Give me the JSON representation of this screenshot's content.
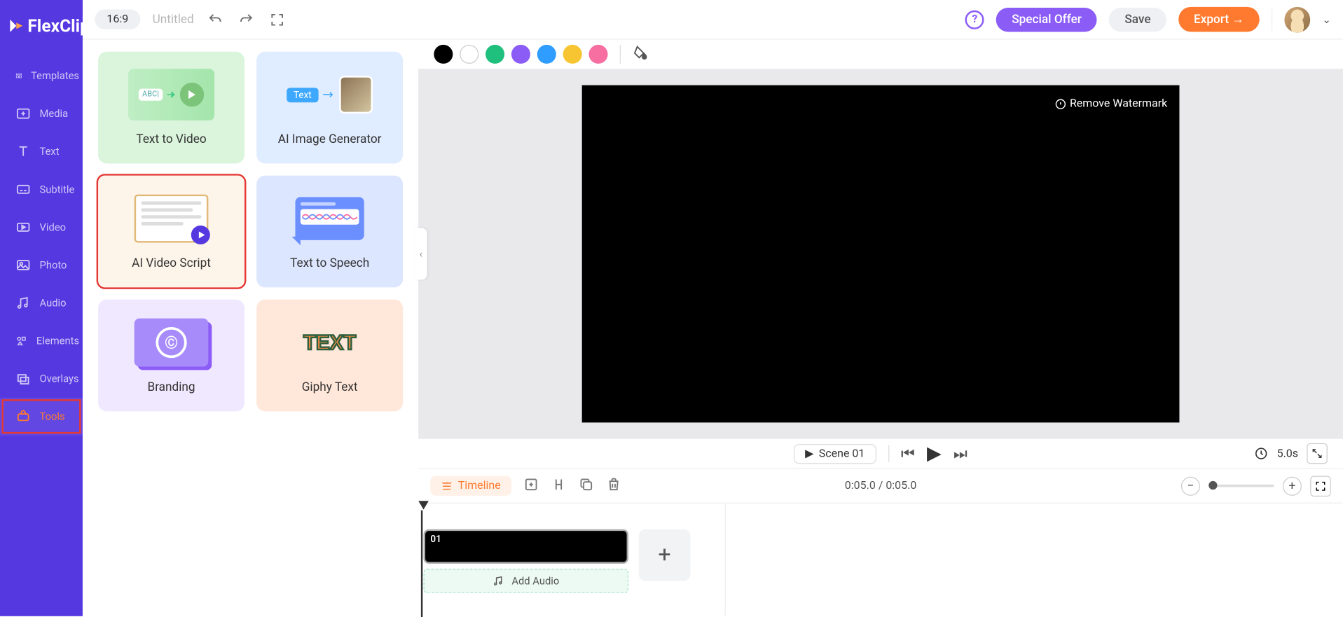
{
  "app": {
    "logo": "FlexClip"
  },
  "topbar": {
    "aspect": "16:9",
    "title": "Untitled",
    "help": "?",
    "special": "Special Offer",
    "save": "Save",
    "export": "Export →"
  },
  "sidebar": {
    "items": [
      {
        "label": "Templates"
      },
      {
        "label": "Media"
      },
      {
        "label": "Text"
      },
      {
        "label": "Subtitle"
      },
      {
        "label": "Video"
      },
      {
        "label": "Photo"
      },
      {
        "label": "Audio"
      },
      {
        "label": "Elements"
      },
      {
        "label": "Overlays"
      },
      {
        "label": "Tools"
      }
    ]
  },
  "tools": {
    "card1": "Text to Video",
    "card2": "AI Image Generator",
    "card3": "AI Video Script",
    "card4": "Text to Speech",
    "card5": "Branding",
    "card6": "Giphy Text",
    "ai_tag": "Text"
  },
  "canvas": {
    "watermark": "Remove Watermark",
    "scene_label": "Scene 01",
    "duration": "5.0s"
  },
  "timeline": {
    "label": "Timeline",
    "time": "0:05.0 / 0:05.0",
    "clip_id": "01",
    "add_audio": "Add Audio"
  },
  "colors": [
    "#000",
    "#fff",
    "#1fbf7e",
    "#8b5cf6",
    "#2f9cff",
    "#f7c531",
    "#f76ea0"
  ]
}
